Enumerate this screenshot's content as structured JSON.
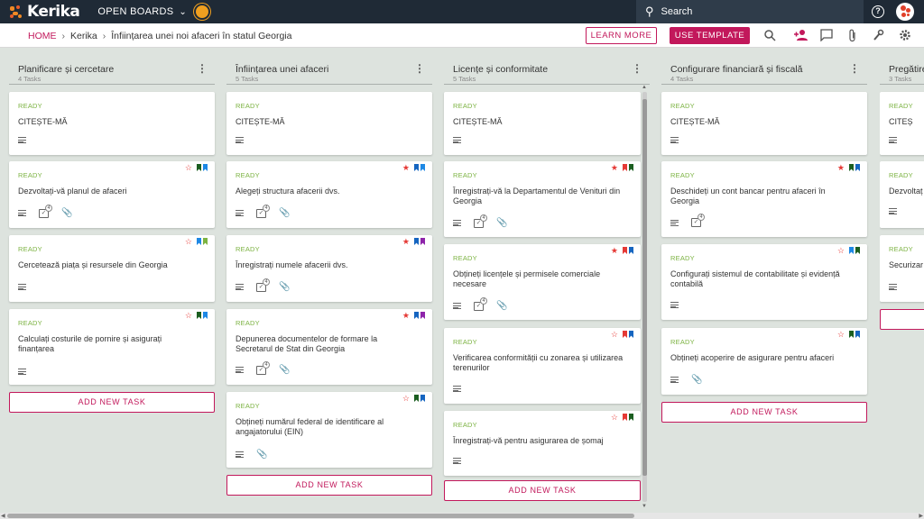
{
  "app": {
    "logo_text": "Kerika",
    "open_boards_label": "OPEN BOARDS",
    "search_placeholder": "Search",
    "help_label": "?"
  },
  "breadcrumb": {
    "home": "HOME",
    "parent": "Kerika",
    "current": "Înființarea unei noi afaceri în statul Georgia"
  },
  "toolbar": {
    "learn_more": "LEARN MORE",
    "use_template": "USE TEMPLATE"
  },
  "colors": {
    "accent": "#c2185b",
    "status_ready": "#7cb342",
    "topbar": "#1f2a36",
    "background": "#dde3de"
  },
  "columns": [
    {
      "title": "Planificare și cercetare",
      "count": "4 Tasks",
      "add_label": "ADD NEW TASK",
      "cards": [
        {
          "status": "READY",
          "title": "CITEȘTE-MĂ",
          "icons": [
            "lines"
          ],
          "star": "none",
          "bookmarks": []
        },
        {
          "status": "READY",
          "title": "Dezvoltați-vă planul de afaceri",
          "icons": [
            "lines",
            "check",
            "clip"
          ],
          "check_count": "4",
          "star": "empty",
          "bookmarks": [
            "#1b5e20",
            "#1e88e5"
          ]
        },
        {
          "status": "READY",
          "title": "Cercetează piața și resursele din Georgia",
          "icons": [
            "lines"
          ],
          "star": "empty",
          "bookmarks": [
            "#1e88e5",
            "#7cb342"
          ]
        },
        {
          "status": "READY",
          "title": "Calculați costurile de pornire și asigurați finanțarea",
          "icons": [
            "lines"
          ],
          "star": "empty",
          "bookmarks": [
            "#1b5e20",
            "#1e88e5"
          ]
        }
      ]
    },
    {
      "title": "Înființarea unei afaceri",
      "count": "5 Tasks",
      "add_label": "ADD NEW TASK",
      "cards": [
        {
          "status": "READY",
          "title": "CITEȘTE-MĂ",
          "icons": [
            "lines"
          ],
          "star": "none",
          "bookmarks": []
        },
        {
          "status": "READY",
          "title": "Alegeți structura afacerii dvs.",
          "icons": [
            "lines",
            "check",
            "clip"
          ],
          "check_count": "4",
          "star": "full",
          "bookmarks": [
            "#1565c0",
            "#1e88e5"
          ]
        },
        {
          "status": "READY",
          "title": "Înregistrați numele afacerii dvs.",
          "icons": [
            "lines",
            "check",
            "clip"
          ],
          "check_count": "4",
          "star": "full",
          "bookmarks": [
            "#1565c0",
            "#8e24aa"
          ]
        },
        {
          "status": "READY",
          "title": "Depunerea documentelor de formare la Secretarul de Stat din Georgia",
          "icons": [
            "lines",
            "check",
            "clip"
          ],
          "check_count": "4",
          "star": "full",
          "bookmarks": [
            "#1565c0",
            "#8e24aa"
          ]
        },
        {
          "status": "READY",
          "title": "Obțineți numărul federal de identificare al angajatorului (EIN)",
          "icons": [
            "lines",
            "clip"
          ],
          "star": "empty",
          "bookmarks": [
            "#1b5e20",
            "#1565c0"
          ]
        }
      ]
    },
    {
      "title": "Licențe și conformitate",
      "count": "5 Tasks",
      "add_label": "ADD NEW TASK",
      "cards": [
        {
          "status": "READY",
          "title": "CITEȘTE-MĂ",
          "icons": [
            "lines"
          ],
          "star": "none",
          "bookmarks": []
        },
        {
          "status": "READY",
          "title": "Înregistrați-vă la Departamentul de Venituri din Georgia",
          "icons": [
            "lines",
            "check",
            "clip"
          ],
          "check_count": "4",
          "star": "full",
          "bookmarks": [
            "#e53935",
            "#1b5e20"
          ]
        },
        {
          "status": "READY",
          "title": "Obțineți licențele și permisele comerciale necesare",
          "icons": [
            "lines",
            "check",
            "clip"
          ],
          "check_count": "4",
          "star": "full",
          "bookmarks": [
            "#e53935",
            "#1565c0"
          ]
        },
        {
          "status": "READY",
          "title": "Verificarea conformității cu zonarea și utilizarea terenurilor",
          "icons": [
            "lines"
          ],
          "star": "empty",
          "bookmarks": [
            "#e53935",
            "#1565c0"
          ]
        },
        {
          "status": "READY",
          "title": "Înregistrați-vă pentru asigurarea de șomaj",
          "icons": [
            "lines"
          ],
          "star": "empty",
          "bookmarks": [
            "#e53935",
            "#1b5e20"
          ]
        }
      ]
    },
    {
      "title": "Configurare financiară și fiscală",
      "count": "4 Tasks",
      "add_label": "ADD NEW TASK",
      "cards": [
        {
          "status": "READY",
          "title": "CITEȘTE-MĂ",
          "icons": [
            "lines"
          ],
          "star": "none",
          "bookmarks": []
        },
        {
          "status": "READY",
          "title": "Deschideți un cont bancar pentru afaceri în Georgia",
          "icons": [
            "lines",
            "check"
          ],
          "check_count": "4",
          "star": "full",
          "bookmarks": [
            "#1b5e20",
            "#1565c0"
          ]
        },
        {
          "status": "READY",
          "title": "Configurați sistemul de contabilitate și evidență contabilă",
          "icons": [
            "lines"
          ],
          "star": "empty",
          "bookmarks": [
            "#1e88e5",
            "#1b5e20"
          ]
        },
        {
          "status": "READY",
          "title": "Obțineți acoperire de asigurare pentru afaceri",
          "icons": [
            "lines",
            "clip"
          ],
          "star": "empty",
          "bookmarks": [
            "#1b5e20",
            "#1565c0"
          ]
        }
      ]
    },
    {
      "title": "Pregătire",
      "count": "3 Tasks",
      "add_label": "",
      "cards": [
        {
          "status": "READY",
          "title": "CITEȘ",
          "icons": [
            "lines"
          ],
          "star": "none",
          "bookmarks": []
        },
        {
          "status": "READY",
          "title": "Dezvoltaț",
          "icons": [
            "lines"
          ],
          "star": "none",
          "bookmarks": []
        },
        {
          "status": "READY",
          "title": "Securizar",
          "icons": [
            "lines"
          ],
          "star": "none",
          "bookmarks": []
        }
      ]
    }
  ]
}
